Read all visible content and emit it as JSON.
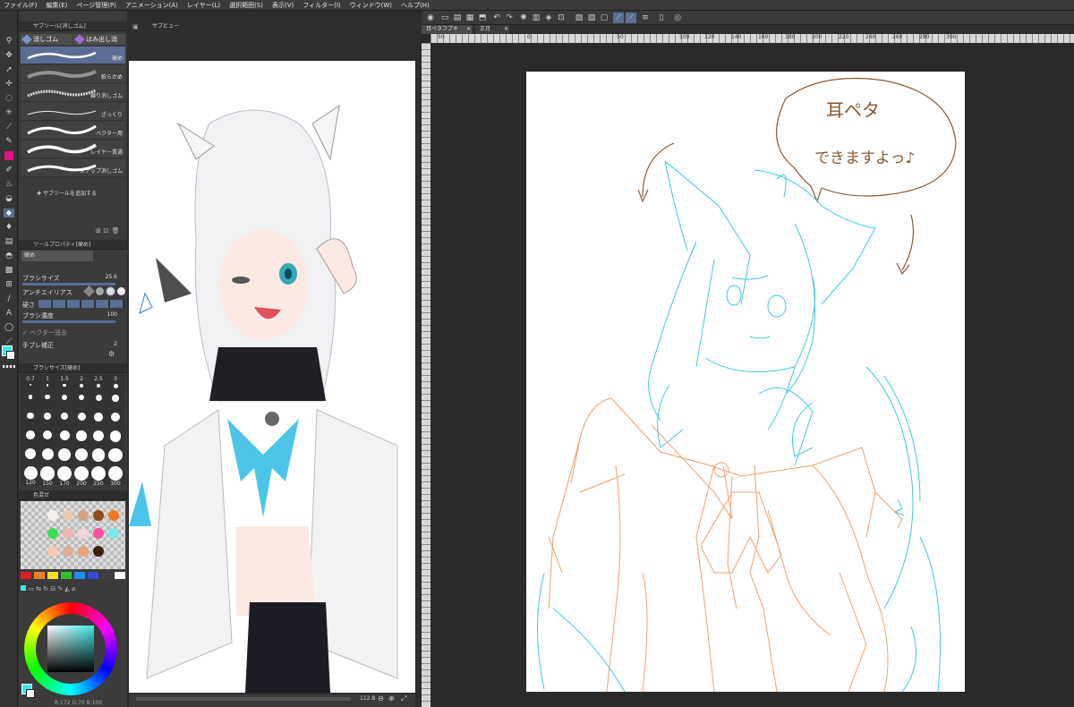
{
  "menu": [
    "ファイル(F)",
    "編集(E)",
    "ページ管理(P)",
    "アニメーション(A)",
    "レイヤー(L)",
    "選択範囲(S)",
    "表示(V)",
    "フィルター(I)",
    "ウィンドウ(W)",
    "ヘルプ(H)"
  ],
  "sub_tool": {
    "panel_title": "サブツール[消しゴム]",
    "tabs": [
      "消しゴム",
      "はみ出し消"
    ],
    "brushes": [
      "硬め",
      "軟らかめ",
      "練り消しゴム",
      "ざっくり",
      "ベクター用",
      "レイヤー貫通",
      "スナップ消しゴム"
    ],
    "add_label": "サブツールを追加する"
  },
  "tool_property": {
    "panel_title": "ツールプロパティ[硬め]",
    "current": "硬め",
    "brush_size_label": "ブラシサイズ",
    "brush_size_value": "25.6",
    "antialias_label": "アンチエイリアス",
    "hardness_label": "硬さ",
    "density_label": "ブラシ濃度",
    "density_value": "100",
    "vector_erase_label": "ベクター消去",
    "stabilizer_label": "手ブレ補正",
    "stabilizer_value": "2"
  },
  "brush_size": {
    "panel_title": "ブラシサイズ[硬め]",
    "sizes": [
      "0.7",
      "1",
      "1.5",
      "2",
      "2.5",
      "3",
      "",
      "",
      "",
      "",
      "",
      "",
      "",
      "",
      "",
      "",
      "",
      "",
      "",
      "",
      "",
      "",
      "",
      "",
      "",
      "",
      "",
      "",
      "",
      "",
      "120",
      "150",
      "170",
      "200",
      "250",
      "300"
    ]
  },
  "color_set": {
    "panel_title": "色混ぜ",
    "swatches": [
      "#f4efe9",
      "#e8c8b0",
      "#d9a57e",
      "#8c4a1f",
      "#f07a1e",
      "#3ddc5a",
      "#e8b9b5",
      "#f5d4da",
      "#ff4fa0",
      "#7ae8f0",
      "#f2c8b0",
      "#dcb09a",
      "#e8a07a",
      "#3a2010"
    ],
    "palette": [
      "#e02020",
      "#f08020",
      "#f0e020",
      "#30c030",
      "#2090f0",
      "#3050d0",
      "#404040",
      "#ffffff"
    ]
  },
  "preview": {
    "panel_title": "サブビュー",
    "zoom": "112.8",
    "status": "R:172 G:70 B:100"
  },
  "canvas": {
    "tabs": [
      "耳ペタフブキ",
      "正月"
    ],
    "ruler_marks": [
      "50",
      "0",
      "50",
      "100",
      "120",
      "140",
      "160",
      "180",
      "200",
      "220",
      "240",
      "260",
      "280",
      "300"
    ],
    "speech_line1": "耳ペタ",
    "speech_line2": "できますよっ♪"
  },
  "colors": {
    "accent": "#5a6d94",
    "line_cyan": "#3ec8e0",
    "line_orange": "#f0a070",
    "line_brown": "#8a5a32",
    "main_color": "#3ee8e8"
  }
}
